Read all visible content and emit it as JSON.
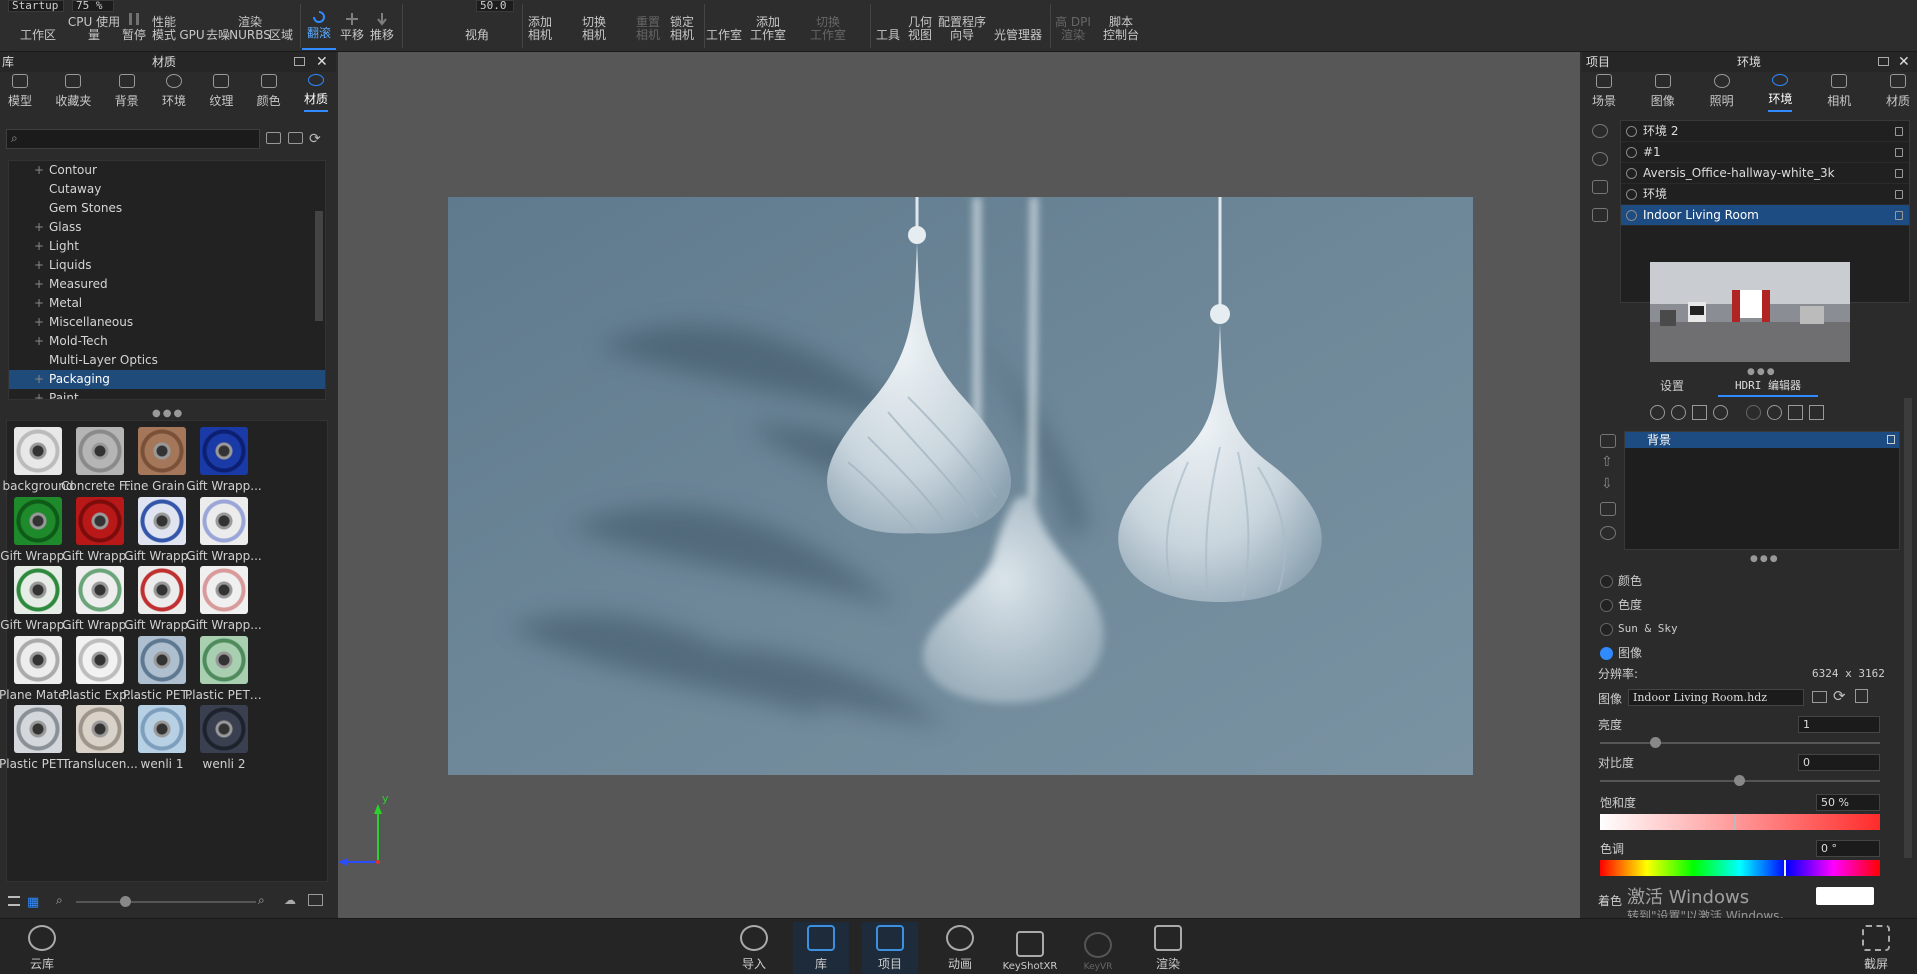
{
  "toolbar": {
    "preset_input": "Startup",
    "zoom_input": "75 %",
    "fov_input": "50.0",
    "workspace": "工作区",
    "cpu_usage": "CPU 使用量",
    "pause": "暂停",
    "perf_mode": "性能\n模式",
    "gpu": "GPU",
    "denoise": "去噪",
    "render_nurbs": "渲染\nNURBS",
    "region": "区域",
    "tumble": "翻滚",
    "pan": "平移",
    "dolly": "推移",
    "view_angle": "视角",
    "add_camera": "添加\n相机",
    "switch_camera": "切换\n相机",
    "reset_camera": "重置\n相机",
    "lock_camera": "锁定\n相机",
    "studio": "工作室",
    "add_studio": "添加\n工作室",
    "switch_studio": "切换\n工作室",
    "tools": "工具",
    "geometry_view": "几何\n视图",
    "config_wizard": "配置程序\n向导",
    "light_manager": "光管理器",
    "hi_dpi": "高 DPI\n渲染",
    "script_console": "脚本\n控制台"
  },
  "library": {
    "title_left": "库",
    "title": "材质",
    "tabs": [
      "模型",
      "收藏夹",
      "背景",
      "环境",
      "纹理",
      "颜色",
      "材质"
    ],
    "active_tab": 6,
    "tree": [
      {
        "label": "Contour",
        "plus": "+"
      },
      {
        "label": "Cutaway",
        "plus": ""
      },
      {
        "label": "Gem Stones",
        "plus": ""
      },
      {
        "label": "Glass",
        "plus": "+"
      },
      {
        "label": "Light",
        "plus": "+"
      },
      {
        "label": "Liquids",
        "plus": "+"
      },
      {
        "label": "Measured",
        "plus": "+"
      },
      {
        "label": "Metal",
        "plus": "+"
      },
      {
        "label": "Miscellaneous",
        "plus": "+"
      },
      {
        "label": "Mold-Tech",
        "plus": "+"
      },
      {
        "label": "Multi-Layer Optics",
        "plus": ""
      },
      {
        "label": "Packaging",
        "plus": "+"
      },
      {
        "label": "Paint",
        "plus": "+"
      }
    ],
    "selected_tree": 11,
    "materials": [
      {
        "label": "background",
        "color": "#e8e8e8",
        "ring": "#bbbbbb"
      },
      {
        "label": "Concrete Fl...",
        "color": "#b5b5b5",
        "ring": "#8a8a8a"
      },
      {
        "label": "Fine Grain ...",
        "color": "#a4775a",
        "ring": "#7a5038"
      },
      {
        "label": "Gift Wrapp...",
        "color": "#1a3aa8",
        "ring": "#0c1f70"
      },
      {
        "label": "Gift Wrapp...",
        "color": "#1f8a2c",
        "ring": "#0e5a18"
      },
      {
        "label": "Gift Wrapp...",
        "color": "#b81818",
        "ring": "#7a0c0c"
      },
      {
        "label": "Gift Wrapp...",
        "color": "#dfe4f0",
        "ring": "#3355aa"
      },
      {
        "label": "Gift Wrapp...",
        "color": "#ececec",
        "ring": "#9aa6d8"
      },
      {
        "label": "Gift Wrapp...",
        "color": "#e6ece6",
        "ring": "#2d8a3c"
      },
      {
        "label": "Gift Wrapp...",
        "color": "#eeeeee",
        "ring": "#6aa57a"
      },
      {
        "label": "Gift Wrapp...",
        "color": "#ececec",
        "ring": "#c03030"
      },
      {
        "label": "Gift Wrapp...",
        "color": "#f0f0f0",
        "ring": "#d89a9a"
      },
      {
        "label": "Plane Mate...",
        "color": "#ededed",
        "ring": "#aaaaaa"
      },
      {
        "label": "Plastic Exp...",
        "color": "#f2f2f2",
        "ring": "#bdbdbd"
      },
      {
        "label": "Plastic PET ...",
        "color": "#aebfd0",
        "ring": "#5d7890"
      },
      {
        "label": "Plastic PET ...",
        "color": "#a8cfb0",
        "ring": "#4e8a5c"
      },
      {
        "label": "Plastic PET ...",
        "color": "#d4d8dc",
        "ring": "#8a9097"
      },
      {
        "label": "Translucen...",
        "color": "#d9d2c8",
        "ring": "#9d948a"
      },
      {
        "label": "wenli 1",
        "color": "#b8d0e4",
        "ring": "#7d9fbd"
      },
      {
        "label": "wenli 2",
        "color": "#3b4050",
        "ring": "#1e222c"
      }
    ]
  },
  "project": {
    "title_left": "项目",
    "title": "环境",
    "tabs": [
      "场景",
      "图像",
      "照明",
      "环境",
      "相机",
      "材质"
    ],
    "active_tab": 3,
    "environments": [
      {
        "label": "环境 2"
      },
      {
        "label": " #1"
      },
      {
        "label": "Aversis_Office-hallway-white_3k"
      },
      {
        "label": "环境"
      },
      {
        "label": "Indoor Living Room"
      }
    ],
    "selected_env": 4,
    "subtabs": [
      "设置",
      "HDRI 编辑器"
    ],
    "active_subtab": 1,
    "layer_item": "背景",
    "radios": [
      "颜色",
      "色度",
      "Sun & Sky",
      "图像"
    ],
    "radio_on": 3,
    "resolution_label": "分辨率:",
    "resolution_value": "6324 x 3162",
    "image_label": "图像",
    "image_file": "Indoor Living Room.hdz",
    "brightness_label": "亮度",
    "brightness_value": "1",
    "contrast_label": "对比度",
    "contrast_value": "0",
    "saturation_label": "饱和度",
    "saturation_value": "50 %",
    "hue_label": "色调",
    "hue_value": "0 °",
    "tint_label": "着色",
    "watermark_line1": "激活 Windows",
    "watermark_line2": "转到\"设置\"以激活 Windows。"
  },
  "bottom": {
    "cloud_library": "云库",
    "import": "导入",
    "library": "库",
    "project": "项目",
    "animation": "动画",
    "keyshotxr": "KeyShotXR",
    "keyvr": "KeyVR",
    "render": "渲染",
    "screenshot": "截屏",
    "active": "project"
  },
  "viewport": {
    "axis_y": "y"
  },
  "colors": {
    "accent": "#2f8bff",
    "selection": "#1d4c82",
    "viewport_bg": "#575757",
    "render_bg": "#6d8798"
  }
}
